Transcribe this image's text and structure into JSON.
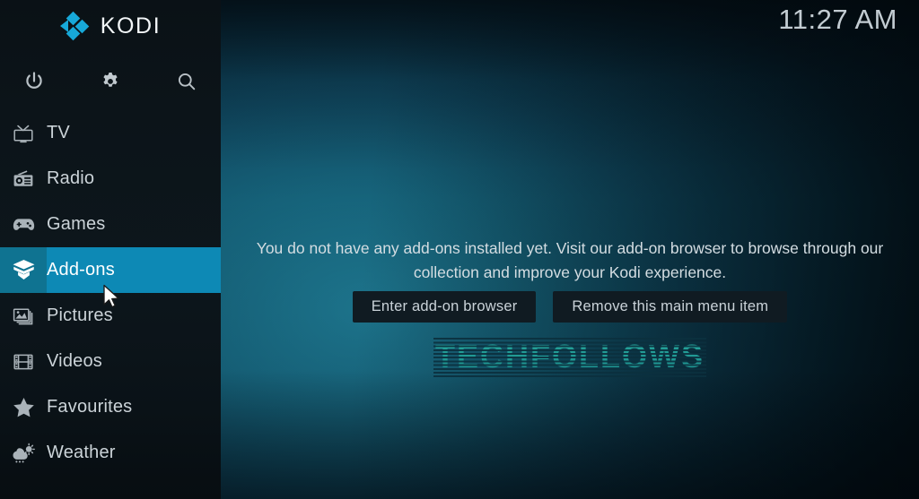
{
  "app": {
    "name": "KODI",
    "logo_icon": "kodi-logo-icon",
    "accent_color": "#0d89b5",
    "accent_dark_color": "#0f7391",
    "sidebar_bg_color": "#0c1419"
  },
  "clock": {
    "time": "11:27 AM"
  },
  "sidebar": {
    "actions": [
      {
        "name": "power-button",
        "icon": "power-icon",
        "label": "Power"
      },
      {
        "name": "settings-button",
        "icon": "gear-icon",
        "label": "Settings"
      },
      {
        "name": "search-button",
        "icon": "search-icon",
        "label": "Search"
      }
    ],
    "items": [
      {
        "label": "TV",
        "icon": "tv-icon",
        "selected": false
      },
      {
        "label": "Radio",
        "icon": "radio-icon",
        "selected": false
      },
      {
        "label": "Games",
        "icon": "gamepad-icon",
        "selected": false
      },
      {
        "label": "Add-ons",
        "icon": "addons-box-icon",
        "selected": true
      },
      {
        "label": "Pictures",
        "icon": "pictures-icon",
        "selected": false
      },
      {
        "label": "Videos",
        "icon": "film-icon",
        "selected": false
      },
      {
        "label": "Favourites",
        "icon": "star-icon",
        "selected": false
      },
      {
        "label": "Weather",
        "icon": "weather-icon",
        "selected": false
      }
    ]
  },
  "main": {
    "empty_message": "You do not have any add-ons installed yet. Visit our add-on browser to browse through our collection and improve your Kodi experience.",
    "buttons": [
      {
        "label": "Enter add-on browser",
        "name": "enter-addon-browser-button"
      },
      {
        "label": "Remove this main menu item",
        "name": "remove-main-menu-item-button"
      }
    ]
  },
  "watermark": {
    "text": "TECHFOLLOWS",
    "color": "#1d8f92"
  }
}
